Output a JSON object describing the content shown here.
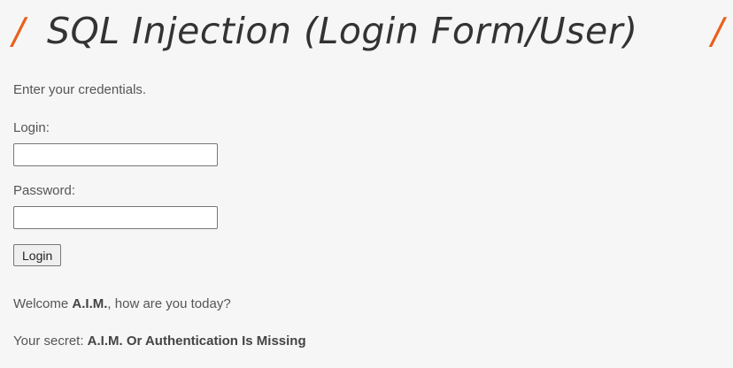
{
  "heading": {
    "slash_left": "/",
    "title": "SQL Injection (Login Form/User)",
    "slash_right": "/"
  },
  "form": {
    "intro": "Enter your credentials.",
    "login_label": "Login:",
    "login_value": "",
    "password_label": "Password:",
    "password_value": "",
    "submit_label": "Login"
  },
  "result": {
    "welcome_prefix": "Welcome ",
    "welcome_name": "A.I.M.",
    "welcome_suffix": ", how are you today?",
    "secret_prefix": "Your secret: ",
    "secret_value": "A.I.M. Or Authentication Is Missing"
  },
  "colors": {
    "accent": "#e8611c",
    "text": "#555555",
    "background": "#f6f6f6"
  }
}
